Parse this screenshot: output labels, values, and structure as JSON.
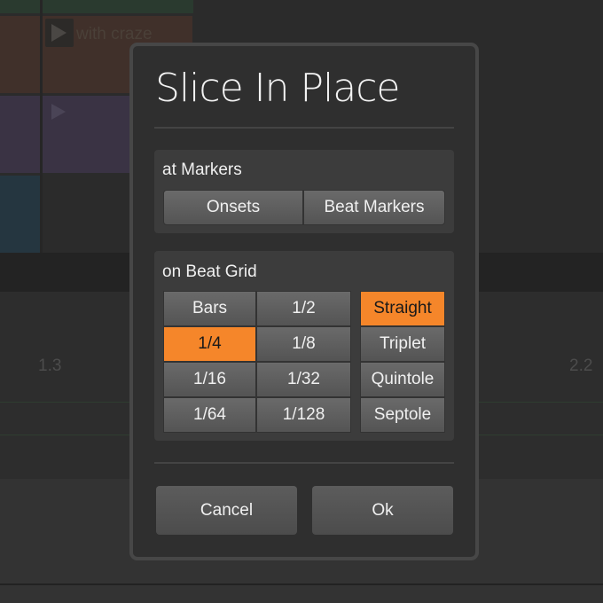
{
  "background": {
    "clip_label": "with craze",
    "ruler_ticks": [
      "1.3",
      "2.2"
    ]
  },
  "dialog": {
    "title": "Slice In Place",
    "markers": {
      "label": "at Markers",
      "buttons": [
        {
          "label": "Onsets",
          "selected": false
        },
        {
          "label": "Beat Markers",
          "selected": false
        }
      ]
    },
    "beat_grid": {
      "label": "on Beat Grid",
      "divisions": [
        {
          "label": "Bars",
          "selected": false
        },
        {
          "label": "1/2",
          "selected": false
        },
        {
          "label": "1/4",
          "selected": true
        },
        {
          "label": "1/8",
          "selected": false
        },
        {
          "label": "1/16",
          "selected": false
        },
        {
          "label": "1/32",
          "selected": false
        },
        {
          "label": "1/64",
          "selected": false
        },
        {
          "label": "1/128",
          "selected": false
        }
      ],
      "feels": [
        {
          "label": "Straight",
          "selected": true
        },
        {
          "label": "Triplet",
          "selected": false
        },
        {
          "label": "Quintole",
          "selected": false
        },
        {
          "label": "Septole",
          "selected": false
        }
      ]
    },
    "cancel_label": "Cancel",
    "ok_label": "Ok"
  },
  "colors": {
    "accent": "#f5862a",
    "dialog_bg": "#2f2f2f",
    "section_bg": "#3c3c3c"
  }
}
